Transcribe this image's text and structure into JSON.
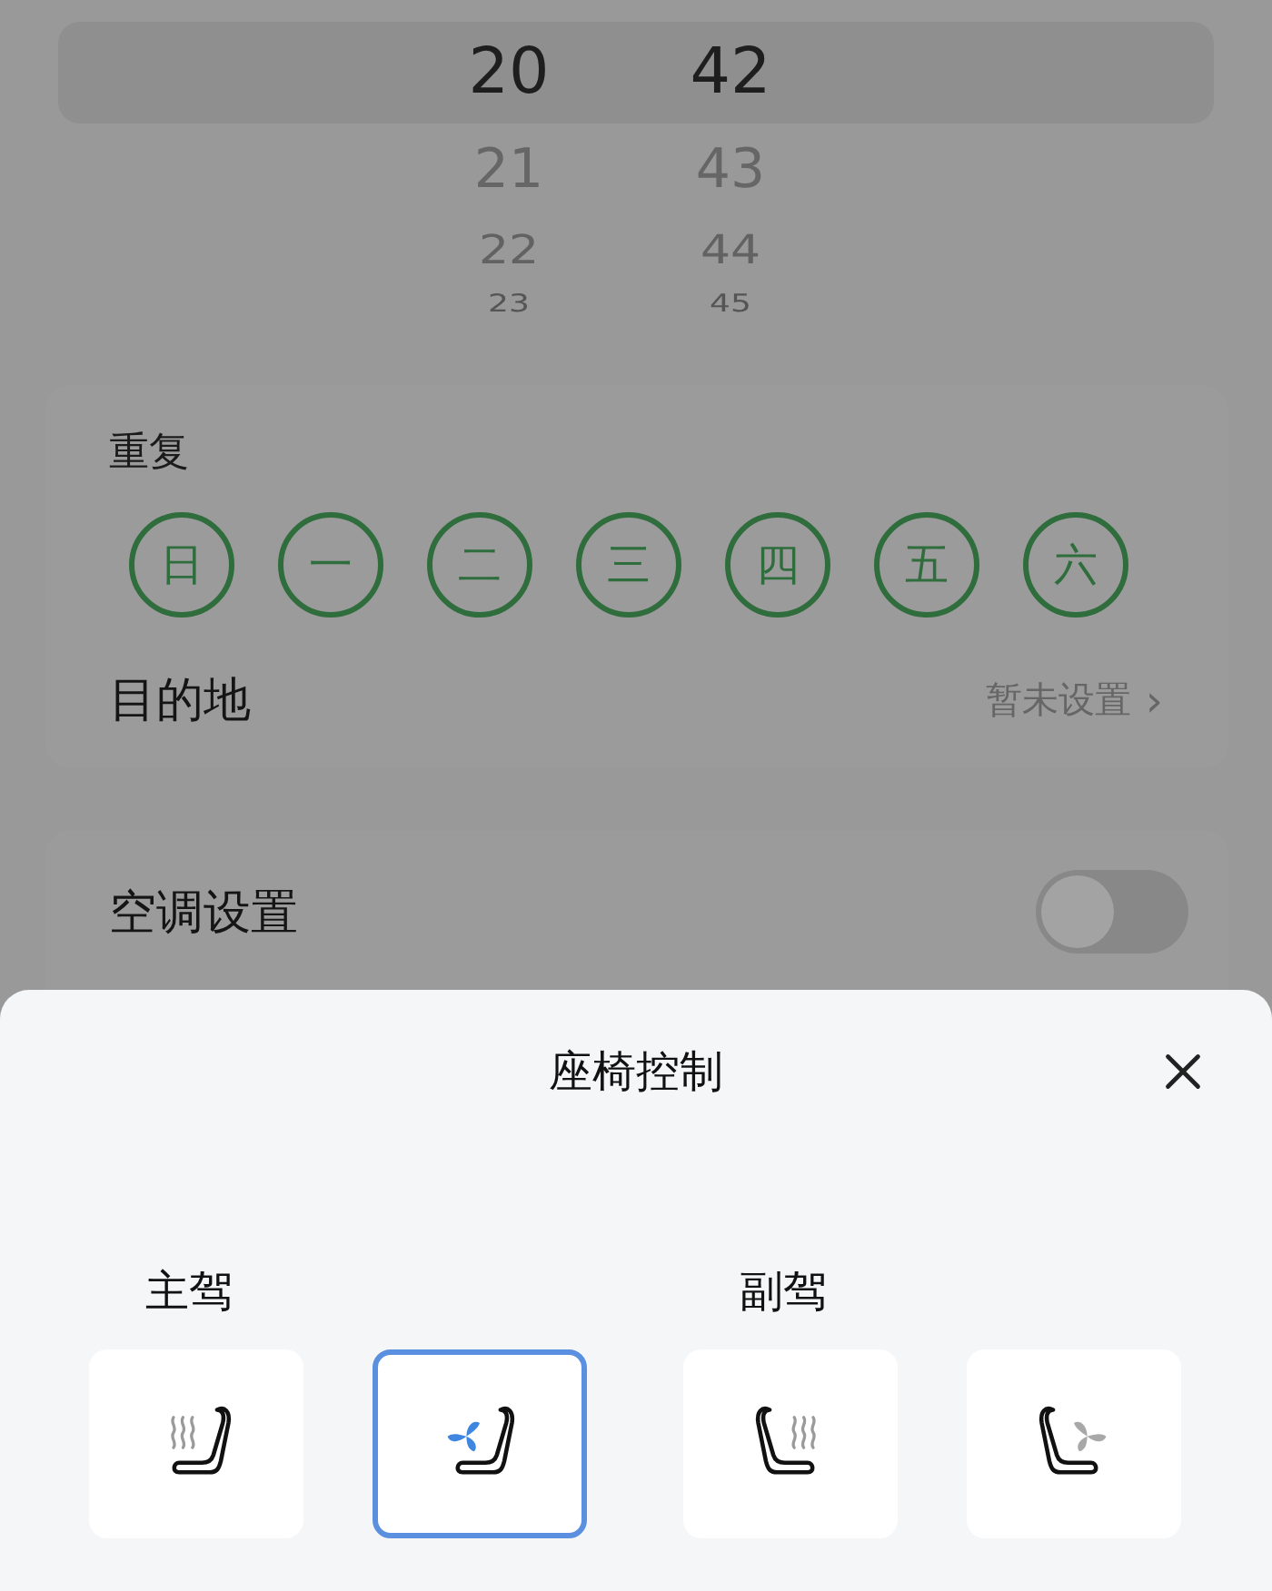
{
  "picker": {
    "columns": [
      {
        "values": [
          "20",
          "21",
          "22",
          "23"
        ]
      },
      {
        "values": [
          "42",
          "43",
          "44",
          "45"
        ]
      }
    ]
  },
  "repeat": {
    "title": "重复",
    "days": [
      {
        "label": "日",
        "selected": true
      },
      {
        "label": "一",
        "selected": true
      },
      {
        "label": "二",
        "selected": true
      },
      {
        "label": "三",
        "selected": true
      },
      {
        "label": "四",
        "selected": true
      },
      {
        "label": "五",
        "selected": true
      },
      {
        "label": "六",
        "selected": true
      }
    ],
    "destination": {
      "label": "目的地",
      "value": "暂未设置",
      "chevron": "›"
    }
  },
  "climate": {
    "label": "空调设置",
    "on": false
  },
  "seat_sheet": {
    "title": "座椅控制",
    "sections": [
      {
        "label": "主驾",
        "mirrored": false,
        "buttons": [
          {
            "kind": "heat",
            "selected": false
          },
          {
            "kind": "vent",
            "selected": true
          }
        ]
      },
      {
        "label": "副驾",
        "mirrored": true,
        "buttons": [
          {
            "kind": "heat",
            "selected": false
          },
          {
            "kind": "vent",
            "selected": false
          }
        ]
      }
    ]
  }
}
